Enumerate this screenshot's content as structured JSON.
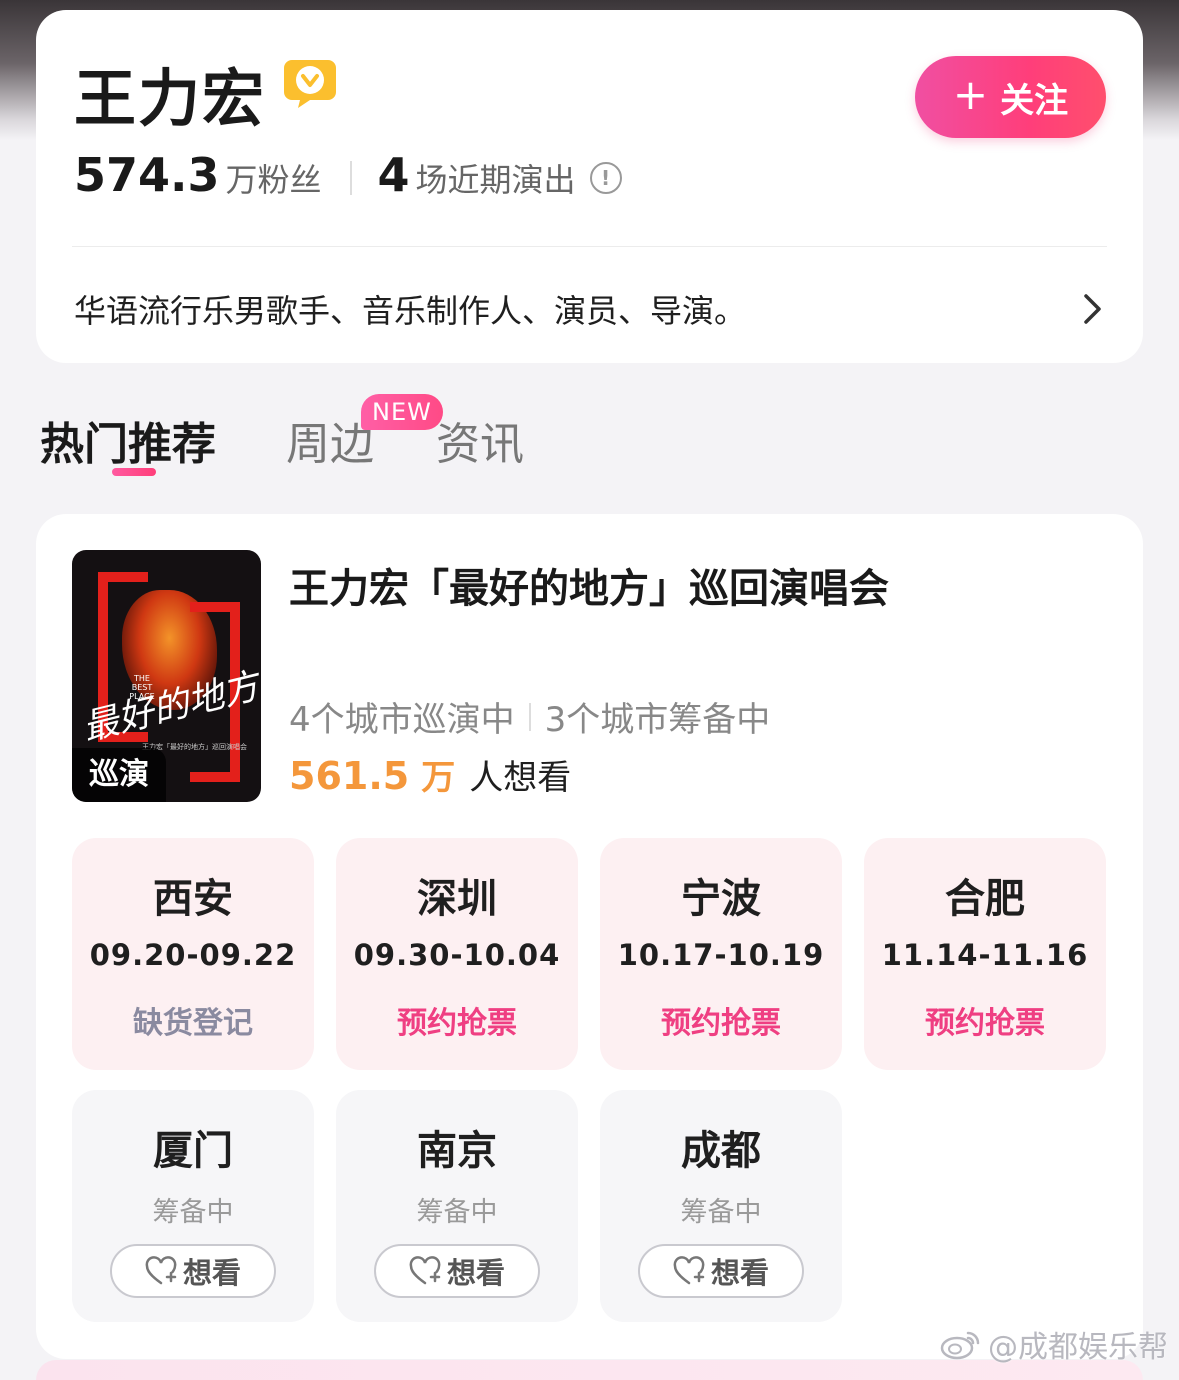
{
  "profile": {
    "name": "王力宏",
    "follow_label": "关注",
    "follow_plus": "+",
    "fans_count": "574.3",
    "fans_label": "万粉丝",
    "shows_count": "4",
    "shows_label": "场近期演出",
    "info_glyph": "!",
    "bio": "华语流行乐男歌手、音乐制作人、演员、导演。"
  },
  "tabs": {
    "hot": "热门推荐",
    "merch": "周边",
    "news": "资讯",
    "new_badge": "NEW"
  },
  "tour": {
    "title": "王力宏「最好的地方」巡回演唱会",
    "poster_tag": "巡演",
    "poster_script": "最好的地方",
    "poster_eng": "THE BEST PLACE",
    "poster_caption": "王力宏「最好的地方」巡回演唱会",
    "touring_cities": "4个城市巡演中",
    "planning_cities": "3个城市筹备中",
    "wants_count": "561.5",
    "wants_unit": "万",
    "wants_label": "人想看"
  },
  "cities_on_sale": [
    {
      "name": "西安",
      "date": "09.20-09.22",
      "action": "缺货登记"
    },
    {
      "name": "深圳",
      "date": "09.30-10.04",
      "action": "预约抢票"
    },
    {
      "name": "宁波",
      "date": "10.17-10.19",
      "action": "预约抢票"
    },
    {
      "name": "合肥",
      "date": "11.14-11.16",
      "action": "预约抢票"
    }
  ],
  "cities_planning": [
    {
      "name": "厦门",
      "status": "筹备中",
      "want_label": "想看"
    },
    {
      "name": "南京",
      "status": "筹备中",
      "want_label": "想看"
    },
    {
      "name": "成都",
      "status": "筹备中",
      "want_label": "想看"
    }
  ],
  "watermark": "@成都娱乐帮",
  "colors": {
    "accent_pink": "#ef3f82",
    "wants_orange": "#f4973b",
    "verified_yellow": "#fbbf2e"
  }
}
